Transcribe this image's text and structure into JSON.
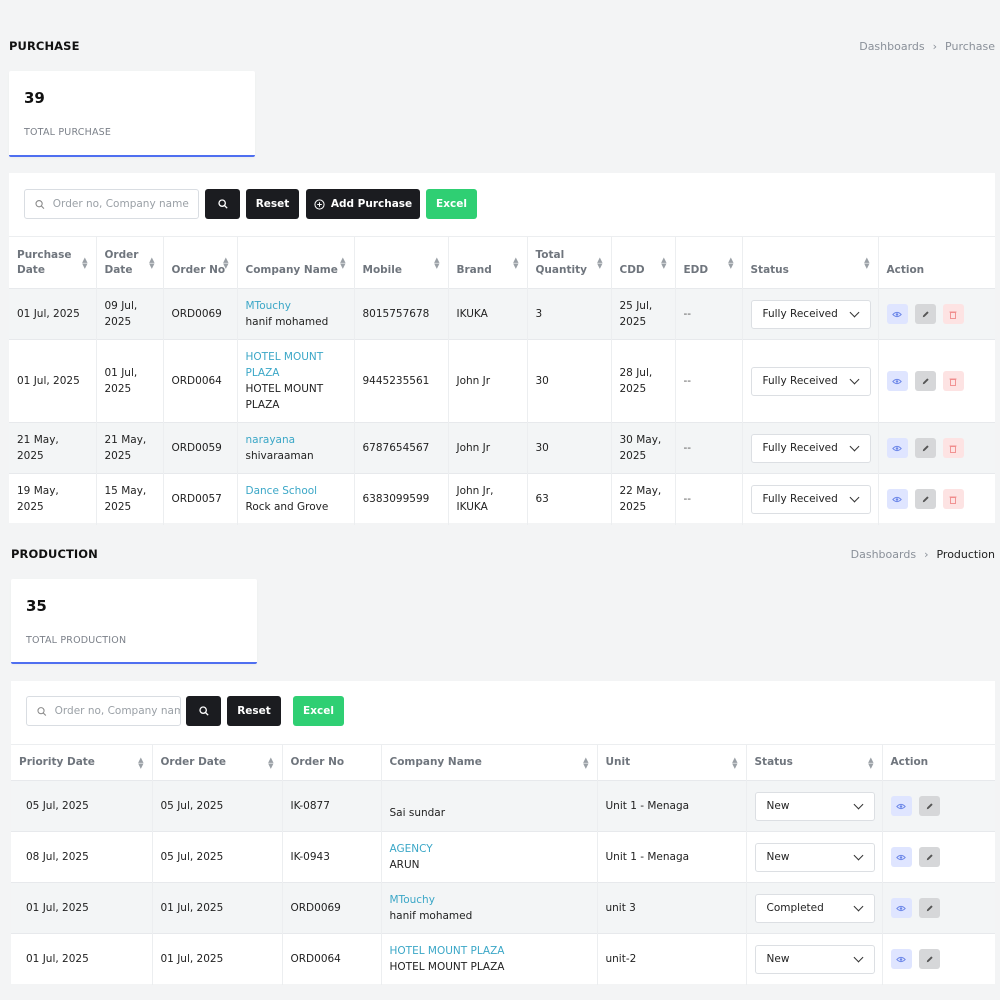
{
  "purchase": {
    "title": "PURCHASE",
    "breadcrumb": [
      "Dashboards",
      "Purchase"
    ],
    "stat": {
      "value": "39",
      "label": "TOTAL PURCHASE"
    },
    "search_placeholder": "Order no, Company name",
    "reset_label": "Reset",
    "add_label": "Add Purchase",
    "excel_label": "Excel",
    "columns": [
      "Purchase Date",
      "Order Date",
      "Order No",
      "Company Name",
      "Mobile",
      "Brand",
      "Total Quantity",
      "CDD",
      "EDD",
      "Status",
      "Action"
    ],
    "rows": [
      {
        "purchase_date": "01 Jul, 2025",
        "order_date": "09 Jul, 2025",
        "order_no": "ORD0069",
        "company_link": "MTouchy",
        "company_name": "hanif mohamed",
        "mobile": "8015757678",
        "brand": "IKUKA",
        "qty": "3",
        "cdd": "25 Jul, 2025",
        "edd": "--",
        "status": "Fully Received"
      },
      {
        "purchase_date": "01 Jul, 2025",
        "order_date": "01 Jul, 2025",
        "order_no": "ORD0064",
        "company_link": "HOTEL MOUNT PLAZA",
        "company_name": "HOTEL MOUNT PLAZA",
        "mobile": "9445235561",
        "brand": "John Jr",
        "qty": "30",
        "cdd": "28 Jul, 2025",
        "edd": "--",
        "status": "Fully Received"
      },
      {
        "purchase_date": "21 May, 2025",
        "order_date": "21 May, 2025",
        "order_no": "ORD0059",
        "company_link": "narayana",
        "company_name": "shivaraaman",
        "mobile": "6787654567",
        "brand": "John Jr",
        "qty": "30",
        "cdd": "30 May, 2025",
        "edd": "--",
        "status": "Fully Received"
      },
      {
        "purchase_date": "19 May, 2025",
        "order_date": "15 May, 2025",
        "order_no": "ORD0057",
        "company_link": "Dance School",
        "company_name": "Rock and Grove",
        "mobile": "6383099599",
        "brand": "John Jr, IKUKA",
        "qty": "63",
        "cdd": "22 May, 2025",
        "edd": "--",
        "status": "Fully Received"
      }
    ]
  },
  "production": {
    "title": "PRODUCTION",
    "breadcrumb": [
      "Dashboards",
      "Production"
    ],
    "stat": {
      "value": "35",
      "label": "TOTAL PRODUCTION"
    },
    "search_placeholder": "Order no, Company name",
    "reset_label": "Reset",
    "excel_label": "Excel",
    "columns": [
      "Priority Date",
      "Order Date",
      "Order No",
      "Company Name",
      "Unit",
      "Status",
      "Action"
    ],
    "rows": [
      {
        "priority_date": "05 Jul, 2025",
        "order_date": "05 Jul, 2025",
        "order_no": "IK-0877",
        "company_link": "",
        "company_name": "Sai sundar",
        "unit": "Unit 1 - Menaga",
        "status": "New"
      },
      {
        "priority_date": "08 Jul, 2025",
        "order_date": "05 Jul, 2025",
        "order_no": "IK-0943",
        "company_link": "AGENCY",
        "company_name": "ARUN",
        "unit": "Unit 1 - Menaga",
        "status": "New"
      },
      {
        "priority_date": "01 Jul, 2025",
        "order_date": "01 Jul, 2025",
        "order_no": "ORD0069",
        "company_link": "MTouchy",
        "company_name": "hanif mohamed",
        "unit": "unit 3",
        "status": "Completed"
      },
      {
        "priority_date": "01 Jul, 2025",
        "order_date": "01 Jul, 2025",
        "order_no": "ORD0064",
        "company_link": "HOTEL MOUNT PLAZA",
        "company_name": "HOTEL MOUNT PLAZA",
        "unit": "unit-2",
        "status": "New"
      }
    ]
  },
  "icons": {
    "search": "search-icon",
    "add": "plus-circle-icon",
    "view": "eye-icon",
    "edit": "pencil-icon",
    "delete": "trash-icon",
    "sort": "sort-icon",
    "dropdown": "chevron-down-icon"
  },
  "colors": {
    "accent": "#4f6ff0",
    "link": "#3ba7c7",
    "dark_button": "#1b1c20",
    "excel_button": "#2fcf73"
  }
}
